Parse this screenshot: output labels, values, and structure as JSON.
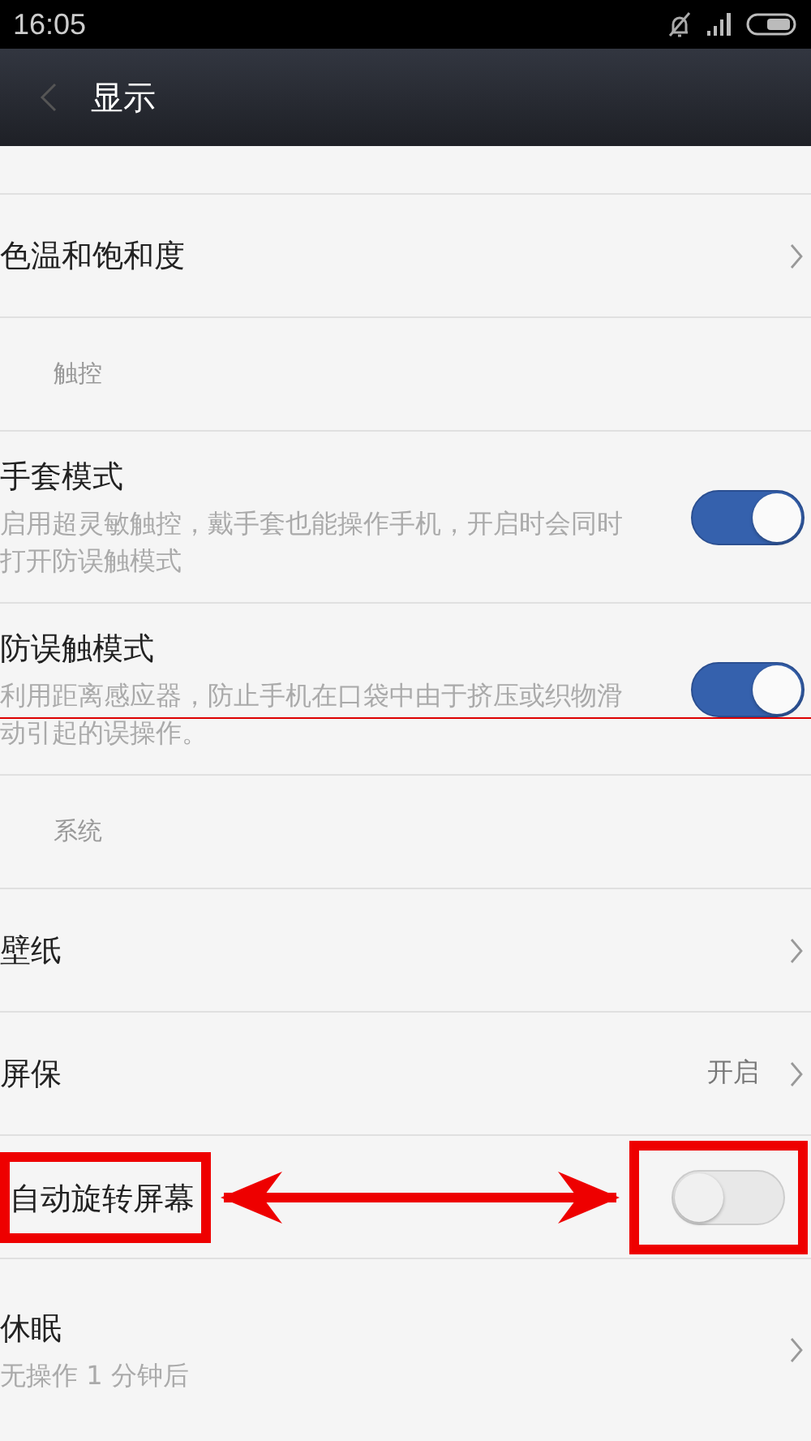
{
  "status_bar": {
    "time": "16:05"
  },
  "header": {
    "title": "显示"
  },
  "items": [
    {
      "kind": "blank"
    },
    {
      "kind": "nav",
      "title": "色温和饱和度"
    },
    {
      "kind": "section",
      "title": "触控"
    },
    {
      "kind": "toggle",
      "title": "手套模式",
      "description": "启用超灵敏触控，戴手套也能操作手机，开启时会同时打开防误触模式",
      "on": true
    },
    {
      "kind": "toggle",
      "title": "防误触模式",
      "description": "利用距离感应器，防止手机在口袋中由于挤压或织物滑动引起的误操作。",
      "on": true,
      "underlined": true
    },
    {
      "kind": "section",
      "title": "系统"
    },
    {
      "kind": "nav",
      "title": "壁纸"
    },
    {
      "kind": "nav",
      "title": "屏保",
      "value": "开启"
    },
    {
      "kind": "toggle",
      "title": "自动旋转屏幕",
      "on": false,
      "highlighted": true
    },
    {
      "kind": "nav",
      "title": "休眠",
      "description": "无操作 1 分钟后"
    }
  ]
}
